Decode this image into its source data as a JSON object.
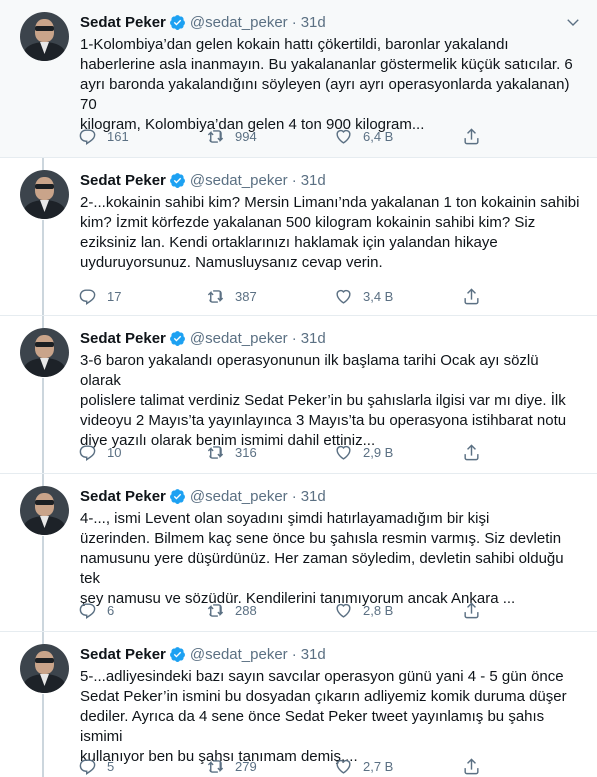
{
  "author": {
    "name": "Sedat Peker",
    "handle": "@sedat_peker",
    "separator": "·",
    "verified": true
  },
  "tweets": [
    {
      "time": "31d",
      "text": "1-Kolombiya’dan gelen kokain hattı çökertildi, baronlar yakalandı\nhaberlerine asla inanmayın. Bu yakalananlar göstermelik küçük satıcılar. 6\nayrı baronda yakalandığını söyleyen (ayrı ayrı operasyonlarda yakalanan) 70\nkilogram, Kolombiya’dan gelen 4 ton 900 kilogram...",
      "replies": "161",
      "retweets": "994",
      "likes": "6,4 B"
    },
    {
      "time": "31d",
      "text": "2-...kokainin sahibi kim? Mersin Limanı’nda yakalanan 1 ton kokainin sahibi\nkim? İzmit körfezde yakalanan 500 kilogram kokainin sahibi kim? Siz\neziksiniz lan. Kendi ortaklarınızı haklamak için yalandan hikaye\nuyduruyorsunuz. Namusluysanız cevap verin.",
      "replies": "17",
      "retweets": "387",
      "likes": "3,4 B"
    },
    {
      "time": "31d",
      "text": "3-6 baron yakalandı operasyonunun ilk başlama tarihi Ocak ayı sözlü olarak\npolislere talimat verdiniz Sedat Peker’in bu şahıslarla ilgisi var mı diye. İlk\nvideoyu 2 Mayıs’ta yayınlayınca 3 Mayıs’ta bu operasyona istihbarat notu\ndiye yazılı olarak benim ismimi dahil ettiniz...",
      "replies": "10",
      "retweets": "316",
      "likes": "2,9 B"
    },
    {
      "time": "31d",
      "text": "4-..., ismi Levent olan soyadını şimdi hatırlayamadığım bir kişi\nüzerinden.  Bilmem kaç sene önce bu şahısla resmin varmış. Siz devletin\nnamusunu yere düşürdünüz. Her zaman söyledim, devletin sahibi olduğu tek\nşey namusu ve sözüdür. Kendilerini tanımıyorum ancak Ankara ...",
      "replies": "6",
      "retweets": "288",
      "likes": "2,8 B"
    },
    {
      "time": "31d",
      "text": "5-...adliyesindeki bazı sayın savcılar operasyon günü yani 4 - 5 gün önce\nSedat Peker’in ismini bu dosyadan çıkarın adliyemiz komik duruma düşer\ndediler. Ayrıca da 4 sene önce Sedat Peker tweet yayınlamış bu şahıs ismimi\nkullanıyor ben bu şahsı tanımam demiş,...",
      "replies": "5",
      "retweets": "279",
      "likes": "2,7 B"
    }
  ],
  "icons": {
    "verified": "verified-badge-icon",
    "more": "more-icon",
    "reply": "reply-icon",
    "retweet": "retweet-icon",
    "like": "like-icon",
    "share": "share-icon"
  },
  "colors": {
    "text": "#0f1419",
    "muted": "#5b7083",
    "verified": "#1da1f2",
    "thread_line": "#ccd6dd",
    "divider": "#e6ecf0",
    "highlight_bg": "#f7f9fa"
  }
}
